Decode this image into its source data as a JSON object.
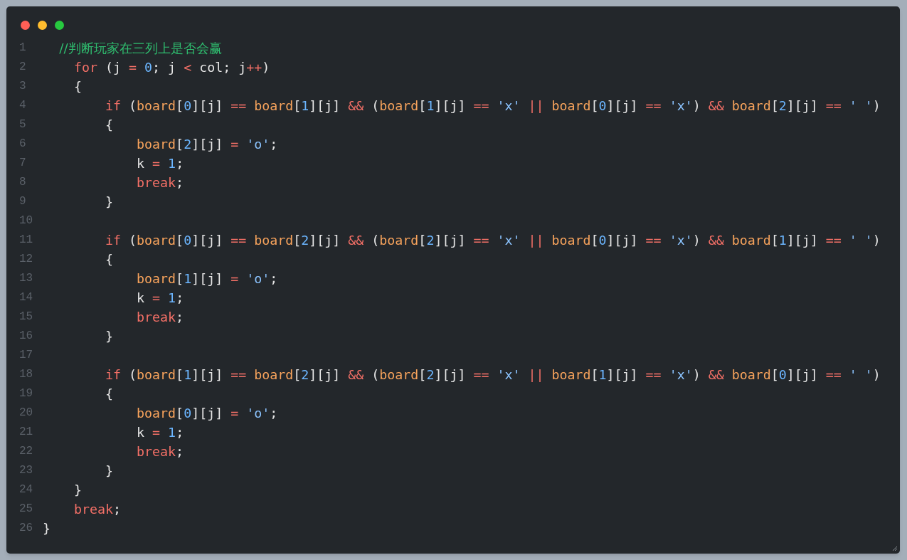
{
  "window": {
    "controls": [
      {
        "kind": "close"
      },
      {
        "kind": "minimize"
      },
      {
        "kind": "zoom"
      }
    ]
  },
  "lines": [
    {
      "number": "1",
      "tokens": [
        {
          "kind": "comment",
          "text": "    //判断玩家在三列上是否会赢"
        }
      ]
    },
    {
      "number": "2",
      "tokens": [
        {
          "kind": "keyword",
          "text": "    for"
        },
        {
          "kind": "plain",
          "text": " (j "
        },
        {
          "kind": "operator",
          "text": "="
        },
        {
          "kind": "number",
          "text": " 0"
        },
        {
          "kind": "plain",
          "text": "; j "
        },
        {
          "kind": "operator",
          "text": "<"
        },
        {
          "kind": "plain",
          "text": " col; j"
        },
        {
          "kind": "operator",
          "text": "++"
        },
        {
          "kind": "plain",
          "text": ")"
        }
      ]
    },
    {
      "number": "3",
      "tokens": [
        {
          "kind": "plain",
          "text": "    {"
        }
      ]
    },
    {
      "number": "4",
      "tokens": [
        {
          "kind": "keyword",
          "text": "        if"
        },
        {
          "kind": "plain",
          "text": " ("
        },
        {
          "kind": "variable",
          "text": "board"
        },
        {
          "kind": "plain",
          "text": "["
        },
        {
          "kind": "number",
          "text": "0"
        },
        {
          "kind": "plain",
          "text": "][j] "
        },
        {
          "kind": "operator",
          "text": "=="
        },
        {
          "kind": "variable",
          "text": " board"
        },
        {
          "kind": "plain",
          "text": "["
        },
        {
          "kind": "number",
          "text": "1"
        },
        {
          "kind": "plain",
          "text": "][j] "
        },
        {
          "kind": "operator",
          "text": "&&"
        },
        {
          "kind": "plain",
          "text": " ("
        },
        {
          "kind": "variable",
          "text": "board"
        },
        {
          "kind": "plain",
          "text": "["
        },
        {
          "kind": "number",
          "text": "1"
        },
        {
          "kind": "plain",
          "text": "][j] "
        },
        {
          "kind": "operator",
          "text": "=="
        },
        {
          "kind": "string",
          "text": " 'x'"
        },
        {
          "kind": "operator",
          "text": " ||"
        },
        {
          "kind": "variable",
          "text": " board"
        },
        {
          "kind": "plain",
          "text": "["
        },
        {
          "kind": "number",
          "text": "0"
        },
        {
          "kind": "plain",
          "text": "][j] "
        },
        {
          "kind": "operator",
          "text": "=="
        },
        {
          "kind": "string",
          "text": " 'x'"
        },
        {
          "kind": "plain",
          "text": ") "
        },
        {
          "kind": "operator",
          "text": "&&"
        },
        {
          "kind": "variable",
          "text": " board"
        },
        {
          "kind": "plain",
          "text": "["
        },
        {
          "kind": "number",
          "text": "2"
        },
        {
          "kind": "plain",
          "text": "][j] "
        },
        {
          "kind": "operator",
          "text": "=="
        },
        {
          "kind": "string",
          "text": " ' '"
        },
        {
          "kind": "plain",
          "text": ")"
        }
      ]
    },
    {
      "number": "5",
      "tokens": [
        {
          "kind": "plain",
          "text": "        {"
        }
      ]
    },
    {
      "number": "6",
      "tokens": [
        {
          "kind": "variable",
          "text": "            board"
        },
        {
          "kind": "plain",
          "text": "["
        },
        {
          "kind": "number",
          "text": "2"
        },
        {
          "kind": "plain",
          "text": "][j] "
        },
        {
          "kind": "operator",
          "text": "="
        },
        {
          "kind": "string",
          "text": " 'o'"
        },
        {
          "kind": "plain",
          "text": ";"
        }
      ]
    },
    {
      "number": "7",
      "tokens": [
        {
          "kind": "plain",
          "text": "            k "
        },
        {
          "kind": "operator",
          "text": "="
        },
        {
          "kind": "number",
          "text": " 1"
        },
        {
          "kind": "plain",
          "text": ";"
        }
      ]
    },
    {
      "number": "8",
      "tokens": [
        {
          "kind": "keyword",
          "text": "            break"
        },
        {
          "kind": "plain",
          "text": ";"
        }
      ]
    },
    {
      "number": "9",
      "tokens": [
        {
          "kind": "plain",
          "text": "        }"
        }
      ]
    },
    {
      "number": "10"
    },
    {
      "number": "11",
      "tokens": [
        {
          "kind": "keyword",
          "text": "        if"
        },
        {
          "kind": "plain",
          "text": " ("
        },
        {
          "kind": "variable",
          "text": "board"
        },
        {
          "kind": "plain",
          "text": "["
        },
        {
          "kind": "number",
          "text": "0"
        },
        {
          "kind": "plain",
          "text": "][j] "
        },
        {
          "kind": "operator",
          "text": "=="
        },
        {
          "kind": "variable",
          "text": " board"
        },
        {
          "kind": "plain",
          "text": "["
        },
        {
          "kind": "number",
          "text": "2"
        },
        {
          "kind": "plain",
          "text": "][j] "
        },
        {
          "kind": "operator",
          "text": "&&"
        },
        {
          "kind": "plain",
          "text": " ("
        },
        {
          "kind": "variable",
          "text": "board"
        },
        {
          "kind": "plain",
          "text": "["
        },
        {
          "kind": "number",
          "text": "2"
        },
        {
          "kind": "plain",
          "text": "][j] "
        },
        {
          "kind": "operator",
          "text": "=="
        },
        {
          "kind": "string",
          "text": " 'x'"
        },
        {
          "kind": "operator",
          "text": " ||"
        },
        {
          "kind": "variable",
          "text": " board"
        },
        {
          "kind": "plain",
          "text": "["
        },
        {
          "kind": "number",
          "text": "0"
        },
        {
          "kind": "plain",
          "text": "][j] "
        },
        {
          "kind": "operator",
          "text": "=="
        },
        {
          "kind": "string",
          "text": " 'x'"
        },
        {
          "kind": "plain",
          "text": ") "
        },
        {
          "kind": "operator",
          "text": "&&"
        },
        {
          "kind": "variable",
          "text": " board"
        },
        {
          "kind": "plain",
          "text": "["
        },
        {
          "kind": "number",
          "text": "1"
        },
        {
          "kind": "plain",
          "text": "][j] "
        },
        {
          "kind": "operator",
          "text": "=="
        },
        {
          "kind": "string",
          "text": " ' '"
        },
        {
          "kind": "plain",
          "text": ")"
        }
      ]
    },
    {
      "number": "12",
      "tokens": [
        {
          "kind": "plain",
          "text": "        {"
        }
      ]
    },
    {
      "number": "13",
      "tokens": [
        {
          "kind": "variable",
          "text": "            board"
        },
        {
          "kind": "plain",
          "text": "["
        },
        {
          "kind": "number",
          "text": "1"
        },
        {
          "kind": "plain",
          "text": "][j] "
        },
        {
          "kind": "operator",
          "text": "="
        },
        {
          "kind": "string",
          "text": " 'o'"
        },
        {
          "kind": "plain",
          "text": ";"
        }
      ]
    },
    {
      "number": "14",
      "tokens": [
        {
          "kind": "plain",
          "text": "            k "
        },
        {
          "kind": "operator",
          "text": "="
        },
        {
          "kind": "number",
          "text": " 1"
        },
        {
          "kind": "plain",
          "text": ";"
        }
      ]
    },
    {
      "number": "15",
      "tokens": [
        {
          "kind": "keyword",
          "text": "            break"
        },
        {
          "kind": "plain",
          "text": ";"
        }
      ]
    },
    {
      "number": "16",
      "tokens": [
        {
          "kind": "plain",
          "text": "        }"
        }
      ]
    },
    {
      "number": "17"
    },
    {
      "number": "18",
      "tokens": [
        {
          "kind": "keyword",
          "text": "        if"
        },
        {
          "kind": "plain",
          "text": " ("
        },
        {
          "kind": "variable",
          "text": "board"
        },
        {
          "kind": "plain",
          "text": "["
        },
        {
          "kind": "number",
          "text": "1"
        },
        {
          "kind": "plain",
          "text": "][j] "
        },
        {
          "kind": "operator",
          "text": "=="
        },
        {
          "kind": "variable",
          "text": " board"
        },
        {
          "kind": "plain",
          "text": "["
        },
        {
          "kind": "number",
          "text": "2"
        },
        {
          "kind": "plain",
          "text": "][j] "
        },
        {
          "kind": "operator",
          "text": "&&"
        },
        {
          "kind": "plain",
          "text": " ("
        },
        {
          "kind": "variable",
          "text": "board"
        },
        {
          "kind": "plain",
          "text": "["
        },
        {
          "kind": "number",
          "text": "2"
        },
        {
          "kind": "plain",
          "text": "][j] "
        },
        {
          "kind": "operator",
          "text": "=="
        },
        {
          "kind": "string",
          "text": " 'x'"
        },
        {
          "kind": "operator",
          "text": " ||"
        },
        {
          "kind": "variable",
          "text": " board"
        },
        {
          "kind": "plain",
          "text": "["
        },
        {
          "kind": "number",
          "text": "1"
        },
        {
          "kind": "plain",
          "text": "][j] "
        },
        {
          "kind": "operator",
          "text": "=="
        },
        {
          "kind": "string",
          "text": " 'x'"
        },
        {
          "kind": "plain",
          "text": ") "
        },
        {
          "kind": "operator",
          "text": "&&"
        },
        {
          "kind": "variable",
          "text": " board"
        },
        {
          "kind": "plain",
          "text": "["
        },
        {
          "kind": "number",
          "text": "0"
        },
        {
          "kind": "plain",
          "text": "][j] "
        },
        {
          "kind": "operator",
          "text": "=="
        },
        {
          "kind": "string",
          "text": " ' '"
        },
        {
          "kind": "plain",
          "text": ")"
        }
      ]
    },
    {
      "number": "19",
      "tokens": [
        {
          "kind": "plain",
          "text": "        {"
        }
      ]
    },
    {
      "number": "20",
      "tokens": [
        {
          "kind": "variable",
          "text": "            board"
        },
        {
          "kind": "plain",
          "text": "["
        },
        {
          "kind": "number",
          "text": "0"
        },
        {
          "kind": "plain",
          "text": "][j] "
        },
        {
          "kind": "operator",
          "text": "="
        },
        {
          "kind": "string",
          "text": " 'o'"
        },
        {
          "kind": "plain",
          "text": ";"
        }
      ]
    },
    {
      "number": "21",
      "tokens": [
        {
          "kind": "plain",
          "text": "            k "
        },
        {
          "kind": "operator",
          "text": "="
        },
        {
          "kind": "number",
          "text": " 1"
        },
        {
          "kind": "plain",
          "text": ";"
        }
      ]
    },
    {
      "number": "22",
      "tokens": [
        {
          "kind": "keyword",
          "text": "            break"
        },
        {
          "kind": "plain",
          "text": ";"
        }
      ]
    },
    {
      "number": "23",
      "tokens": [
        {
          "kind": "plain",
          "text": "        }"
        }
      ]
    },
    {
      "number": "24",
      "tokens": [
        {
          "kind": "plain",
          "text": "    }"
        }
      ]
    },
    {
      "number": "25",
      "tokens": [
        {
          "kind": "keyword",
          "text": "    break"
        },
        {
          "kind": "plain",
          "text": ";"
        }
      ]
    },
    {
      "number": "26",
      "tokens": [
        {
          "kind": "plain",
          "text": "}"
        }
      ]
    }
  ]
}
